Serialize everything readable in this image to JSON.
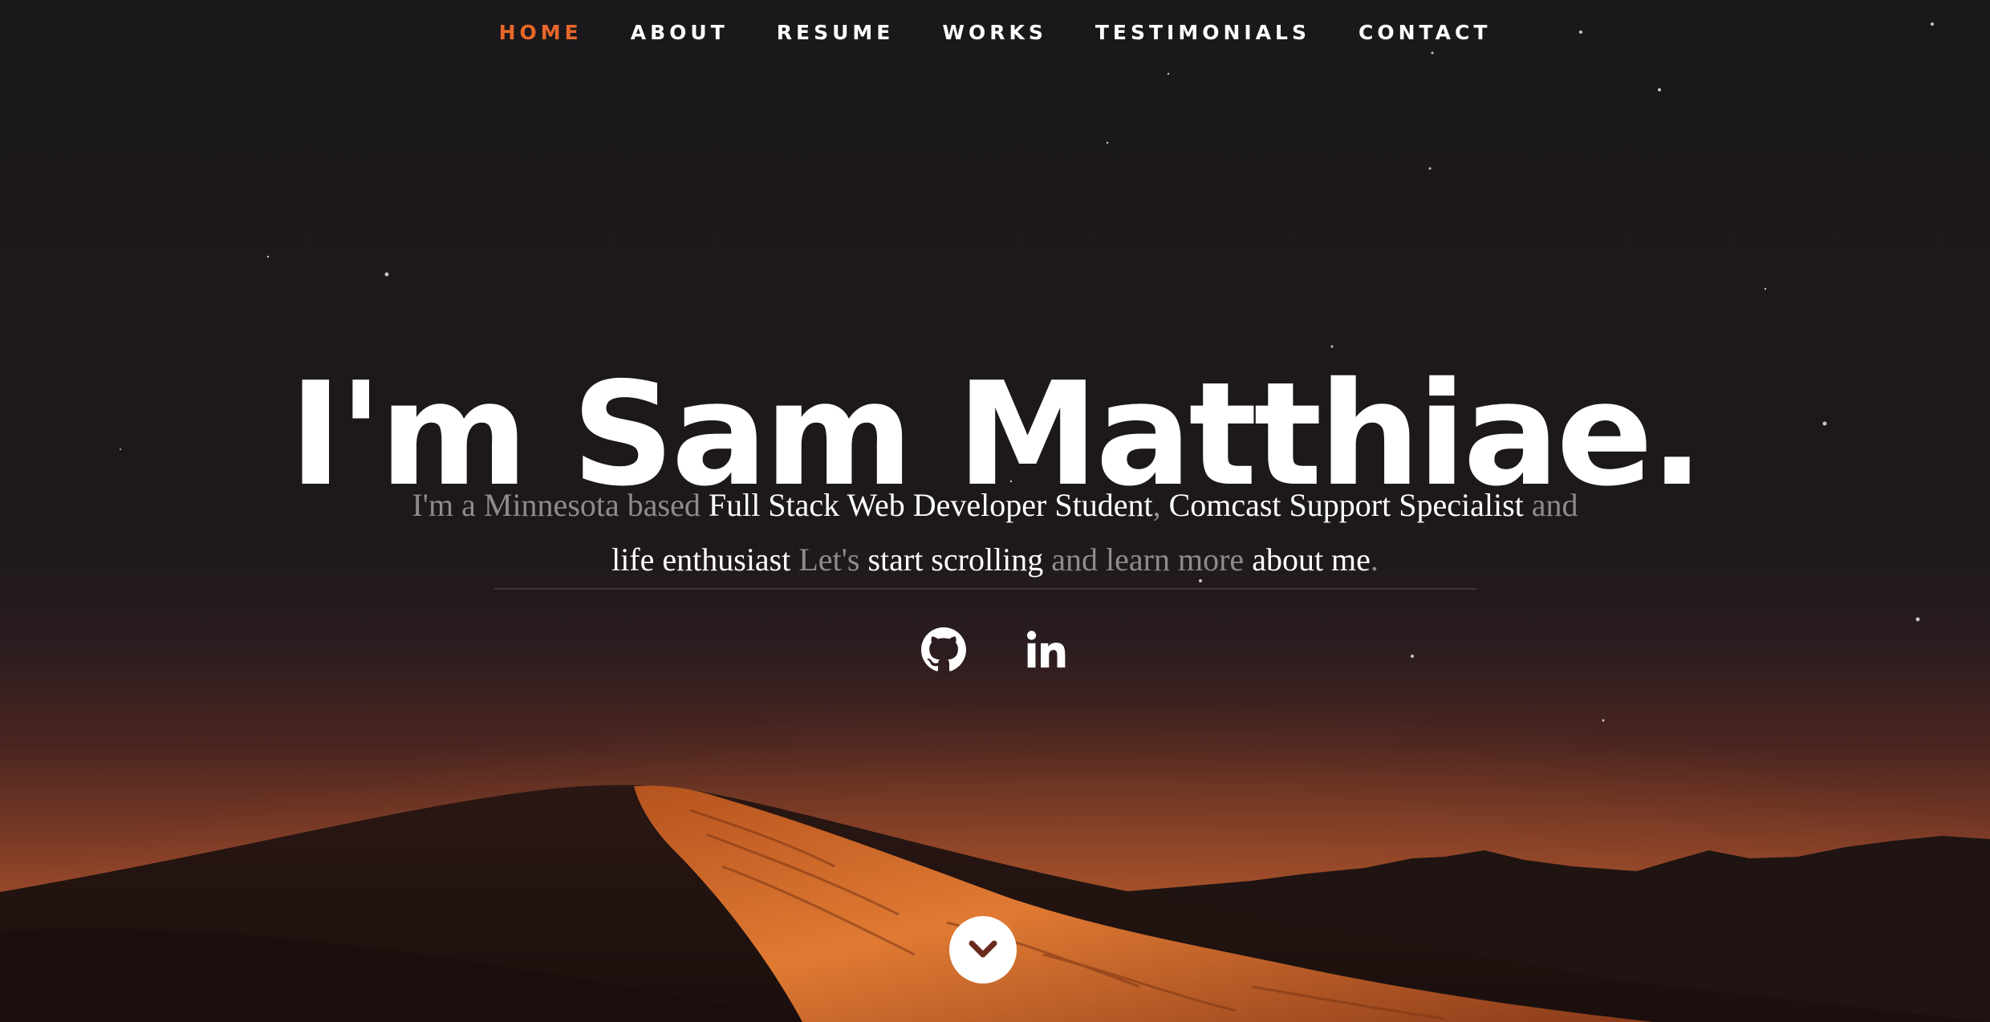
{
  "nav": {
    "items": [
      {
        "label": "HOME",
        "active": true
      },
      {
        "label": "ABOUT",
        "active": false
      },
      {
        "label": "RESUME",
        "active": false
      },
      {
        "label": "WORKS",
        "active": false
      },
      {
        "label": "TESTIMONIALS",
        "active": false
      },
      {
        "label": "CONTACT",
        "active": false
      }
    ],
    "active_color": "#e8682a",
    "text_color": "#ffffff"
  },
  "hero": {
    "headline": "I'm Sam Matthiae.",
    "intro": {
      "part1": "I'm a Minnesota based ",
      "part2": "Full Stack Web Developer Student",
      "part3": ", ",
      "part4": "Comcast Support Specialist",
      "part5": " and ",
      "part6": "life enthusiast",
      "part7": " Let's ",
      "part8": "start scrolling",
      "part9": " and learn more ",
      "part10": "about me",
      "part11": "."
    }
  },
  "social": {
    "items": [
      {
        "name": "github",
        "icon": "github-icon"
      },
      {
        "name": "linkedin",
        "icon": "linkedin-icon"
      }
    ]
  },
  "scroll_button": {
    "icon": "chevron-down-icon",
    "icon_color": "#6b2a1e"
  },
  "colors": {
    "background": "#1b181b",
    "accent": "#e8682a",
    "muted_text": "#8f8a8c"
  }
}
